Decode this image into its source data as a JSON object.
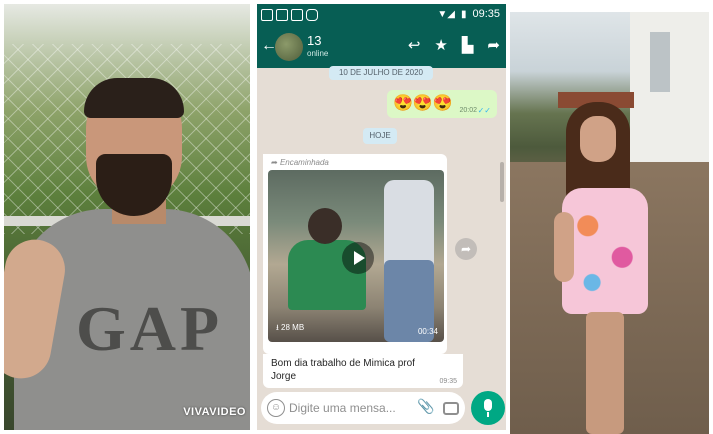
{
  "left_video": {
    "hoodie_text": "GAP",
    "watermark": "VIVAVIDEO"
  },
  "whatsapp": {
    "status_bar": {
      "time": "09:35"
    },
    "header": {
      "participant_count": "13",
      "status": "online"
    },
    "chat": {
      "date_chip": "10 DE JULHO DE 2020",
      "outgoing_message": {
        "text": "😍😍😍",
        "time": "20:02"
      },
      "today_chip": "HOJE",
      "incoming_message": {
        "forwarded_label": "Encaminhada",
        "video_size": "28 MB",
        "video_duration": "00:34",
        "caption": "Bom dia trabalho de Mimica prof Jorge",
        "time": "09:35"
      }
    },
    "composer": {
      "placeholder": "Digite uma mensa..."
    },
    "colors": {
      "header": "#075e54",
      "outgoing_bubble": "#dcf8c6",
      "send_button": "#00a884",
      "chat_background": "#e5ddd5"
    }
  }
}
